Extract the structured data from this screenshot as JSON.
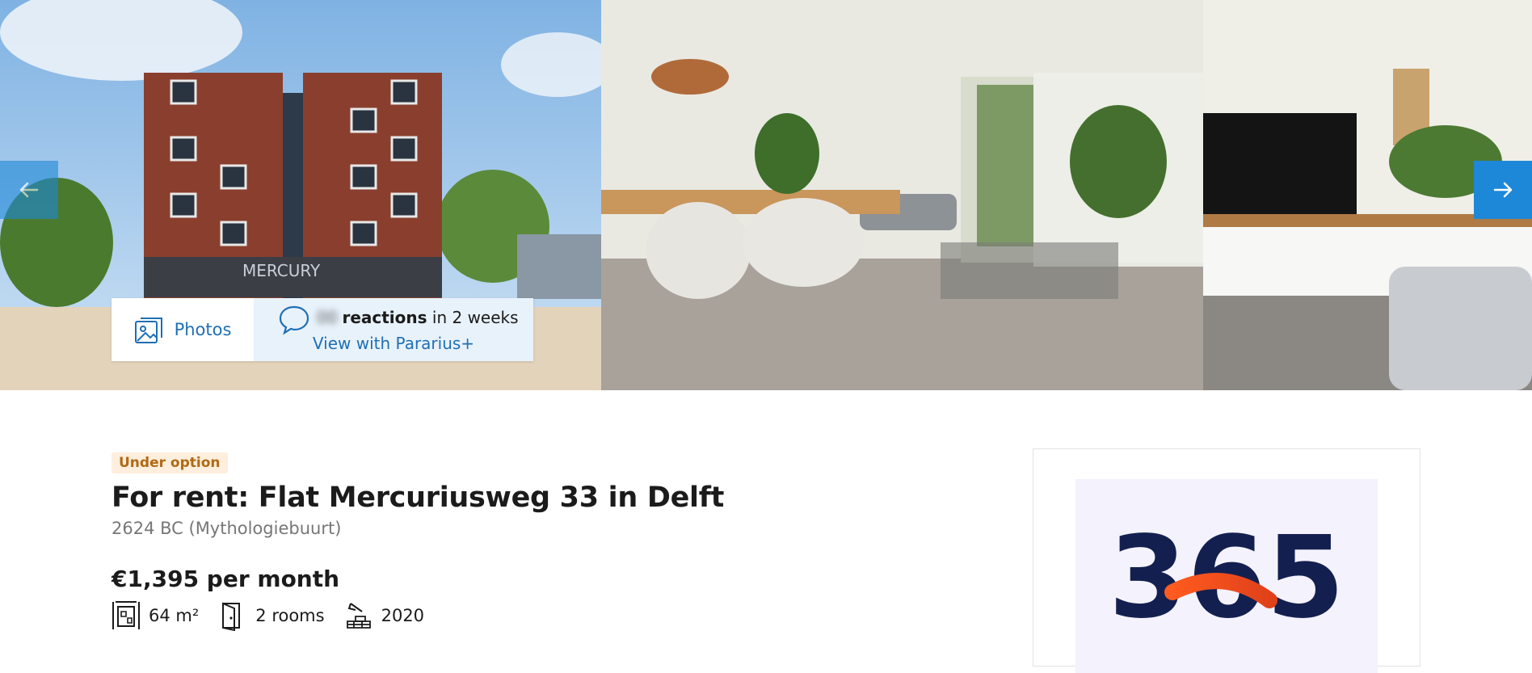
{
  "gallery": {
    "prev_icon": "arrow-left-icon",
    "next_icon": "arrow-right-icon",
    "photos_button_label": "Photos",
    "photos_icon": "photo-gallery-icon",
    "reactions_icon": "chat-bubble-icon",
    "reactions_count": "00",
    "reactions_label": "reactions",
    "reactions_period": "in 2 weeks",
    "pararius_link": "View with Pararius+"
  },
  "listing": {
    "status_badge": "Under option",
    "title": "For rent: Flat Mercuriusweg 33 in Delft",
    "address": "2624 BC (Mythologiebuurt)",
    "price": "€1,395 per month",
    "features": [
      {
        "icon": "surface-area-icon",
        "value": "64 m²"
      },
      {
        "icon": "door-icon",
        "value": "2 rooms"
      },
      {
        "icon": "construction-year-icon",
        "value": "2020"
      }
    ]
  },
  "advert": {
    "logo_text": "365"
  },
  "colors": {
    "accent_blue": "#1e88d8",
    "link_blue": "#1f6fb5",
    "badge_bg": "#fdeedd",
    "badge_text": "#b06a14",
    "reactions_bg": "#e8f2fb"
  }
}
